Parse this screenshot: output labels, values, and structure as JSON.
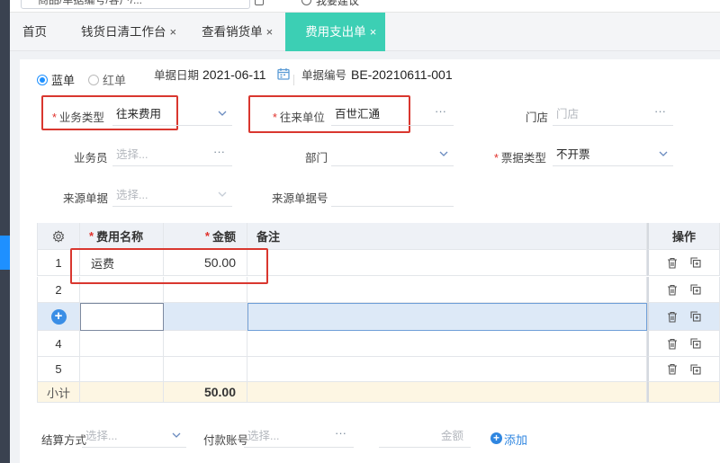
{
  "topbar": {
    "search_text": "商品/单据编号/客户/...",
    "extra_text": "我要建议"
  },
  "tabs": [
    {
      "label": "首页",
      "closable": false,
      "active": false
    },
    {
      "label": "钱货日清工作台",
      "closable": true,
      "active": false
    },
    {
      "label": "查看销货单",
      "closable": true,
      "active": false
    },
    {
      "label": "费用支出单",
      "closable": true,
      "active": true
    }
  ],
  "tab_close_glyph": "×",
  "form": {
    "radio_blue": "蓝单",
    "radio_red": "红单",
    "date_label": "单据日期",
    "date_value": "2021-06-11",
    "number_label": "单据编号",
    "number_value": "BE-20210611-001",
    "required_mark": "*",
    "business_type_label": "业务类型",
    "business_type_value": "往来费用",
    "counterparty_label": "往来单位",
    "counterparty_value": "百世汇通",
    "store_label": "门店",
    "store_placeholder": "门店",
    "salesman_label": "业务员",
    "salesman_placeholder": "选择...",
    "dept_label": "部门",
    "invoice_type_label": "票据类型",
    "invoice_type_value": "不开票",
    "source_label": "来源单据",
    "source_placeholder": "选择...",
    "source_no_label": "来源单据号",
    "more_glyph": "···"
  },
  "table": {
    "headers": {
      "name": "费用名称",
      "amount": "金额",
      "remark": "备注",
      "ops": "操作"
    },
    "rows": [
      {
        "no": "1",
        "name": "运费",
        "amount": "50.00",
        "remark": ""
      },
      {
        "no": "2",
        "name": "",
        "amount": "",
        "remark": ""
      },
      {
        "no": "",
        "name": "",
        "amount": "",
        "remark": ""
      },
      {
        "no": "4",
        "name": "",
        "amount": "",
        "remark": ""
      },
      {
        "no": "5",
        "name": "",
        "amount": "",
        "remark": ""
      }
    ],
    "subtotal_label": "小计",
    "subtotal_amount": "50.00",
    "add_glyph": "+"
  },
  "settlement": {
    "method_label": "结算方式",
    "method_placeholder": "选择...",
    "account_label": "付款账号",
    "account_placeholder": "选择...",
    "amount_placeholder": "金额",
    "add_label": "添加",
    "add_glyph": "+"
  },
  "colors": {
    "accent": "#3ccfb4",
    "primary": "#1e90ff",
    "highlight": "#d9372f",
    "selected_row": "#dde9f7",
    "subtotal_bg": "#fdf6e3"
  }
}
